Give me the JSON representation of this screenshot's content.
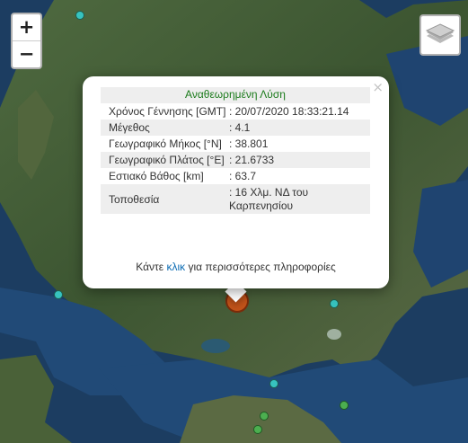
{
  "map": {
    "zoom_in_label": "+",
    "zoom_out_label": "−",
    "layers_icon": "layers-icon",
    "main_event_color": "#c2531a"
  },
  "popup": {
    "close_label": "×",
    "title": "Αναθεωρημένη Λύση",
    "rows": [
      {
        "label": "Χρόνος Γέννησης [GMT]",
        "value": ": 20/07/2020 18:33:21.14"
      },
      {
        "label": "Μέγεθος",
        "value": ": 4.1"
      },
      {
        "label": "Γεωγραφικό Μήκος [°N]",
        "value": ": 38.801"
      },
      {
        "label": "Γεωγραφικό Πλάτος [°E]",
        "value": ": 21.6733"
      },
      {
        "label": "Εστιακό Βάθος [km]",
        "value": ": 63.7"
      },
      {
        "label": "Τοποθεσία",
        "value": ": 16 Χλμ. ΝΔ του Καρπενησίου"
      }
    ],
    "footer": {
      "prefix": "Κάντε ",
      "link": "κλικ",
      "suffix": " για περισσότερες πληροφορίες"
    }
  }
}
